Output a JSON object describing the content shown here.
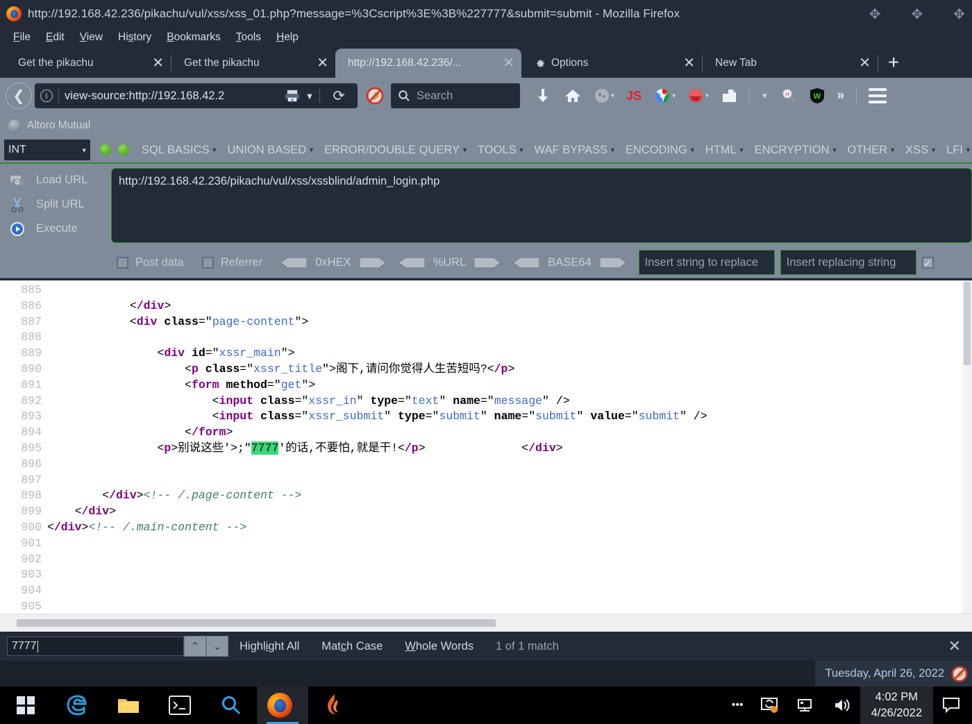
{
  "window": {
    "title": "http://192.168.42.236/pikachu/vul/xss/xss_01.php?message=%3Cscript%3E%3B%227777&submit=submit - Mozilla Firefox",
    "minimize": "—",
    "maximize": "▫",
    "close": "✕"
  },
  "menubar": [
    {
      "label": "File"
    },
    {
      "label": "Edit"
    },
    {
      "label": "View"
    },
    {
      "label": "History"
    },
    {
      "label": "Bookmarks"
    },
    {
      "label": "Tools"
    },
    {
      "label": "Help"
    }
  ],
  "tabs": [
    {
      "label": "Get the pikachu",
      "close": "✕",
      "active": false
    },
    {
      "label": "Get the pikachu",
      "close": "✕",
      "active": false
    },
    {
      "label": "http://192.168.42.236/...",
      "close": "✕",
      "active": true
    },
    {
      "label": "Options",
      "close": "✕",
      "active": false
    },
    {
      "label": "New Tab",
      "close": "✕",
      "active": false
    }
  ],
  "newtab_label": "+",
  "navbar": {
    "back_arrow": "❮",
    "identity_icon": "i",
    "url": "view-source:http://192.168.42.2",
    "dropdown_caret": "▼",
    "reload_glyph": "⟳",
    "search_placeholder": "Search",
    "search_icon": "🔍",
    "js_label": "JS",
    "overflow_caret": "»"
  },
  "bookmarks": [
    {
      "label": "Altoro Mutual"
    }
  ],
  "hackbar": {
    "type_select": "INT",
    "select_caret": "▾",
    "menus": [
      {
        "label": "SQL BASICS"
      },
      {
        "label": "UNION BASED"
      },
      {
        "label": "ERROR/DOUBLE QUERY"
      },
      {
        "label": "TOOLS"
      },
      {
        "label": "WAF BYPASS"
      },
      {
        "label": "ENCODING"
      },
      {
        "label": "HTML"
      },
      {
        "label": "ENCRYPTION"
      },
      {
        "label": "OTHER"
      },
      {
        "label": "XSS"
      },
      {
        "label": "LFI"
      }
    ],
    "actions": [
      {
        "label": "Load URL"
      },
      {
        "label": "Split URL"
      },
      {
        "label": "Execute"
      }
    ],
    "url_value": "http://192.168.42.236/pikachu/vul/xss/xssblind/admin_login.php",
    "post_data_label": "Post data",
    "referrer_label": "Referrer",
    "encoders": [
      {
        "label": "0xHEX"
      },
      {
        "label": "%URL"
      },
      {
        "label": "BASE64"
      }
    ],
    "replace_placeholder": "Insert string to replace",
    "replacing_placeholder": "Insert replacing string"
  },
  "source": {
    "lines": [
      {
        "num": "885",
        "tokens": []
      },
      {
        "num": "886",
        "tokens": [
          {
            "t": "pk",
            "s": "            "
          },
          {
            "t": "pk",
            "s": "<"
          },
          {
            "t": "tg",
            "s": "/div"
          },
          {
            "t": "pk",
            "s": ">"
          }
        ]
      },
      {
        "num": "887",
        "tokens": [
          {
            "t": "pk",
            "s": "            "
          },
          {
            "t": "pk",
            "s": "<"
          },
          {
            "t": "tg",
            "s": "div"
          },
          {
            "t": "at",
            "s": " class"
          },
          {
            "t": "pk",
            "s": "=\""
          },
          {
            "t": "vl",
            "s": "page-content"
          },
          {
            "t": "pk",
            "s": "\">"
          }
        ]
      },
      {
        "num": "888",
        "tokens": []
      },
      {
        "num": "889",
        "tokens": [
          {
            "t": "pk",
            "s": "                "
          },
          {
            "t": "pk",
            "s": "<"
          },
          {
            "t": "tg",
            "s": "div"
          },
          {
            "t": "at",
            "s": " id"
          },
          {
            "t": "pk",
            "s": "=\""
          },
          {
            "t": "vl",
            "s": "xssr_main"
          },
          {
            "t": "pk",
            "s": "\">"
          }
        ]
      },
      {
        "num": "890",
        "tokens": [
          {
            "t": "pk",
            "s": "                    "
          },
          {
            "t": "pk",
            "s": "<"
          },
          {
            "t": "tg",
            "s": "p"
          },
          {
            "t": "at",
            "s": " class"
          },
          {
            "t": "pk",
            "s": "=\""
          },
          {
            "t": "vl",
            "s": "xssr_title"
          },
          {
            "t": "pk",
            "s": "\">"
          },
          {
            "t": "pk",
            "s": "阁下,请问你觉得人生苦短吗?"
          },
          {
            "t": "pk",
            "s": "<"
          },
          {
            "t": "tg",
            "s": "/p"
          },
          {
            "t": "pk",
            "s": ">"
          }
        ]
      },
      {
        "num": "891",
        "tokens": [
          {
            "t": "pk",
            "s": "                    "
          },
          {
            "t": "pk",
            "s": "<"
          },
          {
            "t": "tg",
            "s": "form"
          },
          {
            "t": "at",
            "s": " method"
          },
          {
            "t": "pk",
            "s": "=\""
          },
          {
            "t": "vl",
            "s": "get"
          },
          {
            "t": "pk",
            "s": "\">"
          }
        ]
      },
      {
        "num": "892",
        "tokens": [
          {
            "t": "pk",
            "s": "                        "
          },
          {
            "t": "pk",
            "s": "<"
          },
          {
            "t": "tg",
            "s": "input"
          },
          {
            "t": "at",
            "s": " class"
          },
          {
            "t": "pk",
            "s": "=\""
          },
          {
            "t": "vl",
            "s": "xssr_in"
          },
          {
            "t": "pk",
            "s": "\""
          },
          {
            "t": "at",
            "s": " type"
          },
          {
            "t": "pk",
            "s": "=\""
          },
          {
            "t": "vl",
            "s": "text"
          },
          {
            "t": "pk",
            "s": "\""
          },
          {
            "t": "at",
            "s": " name"
          },
          {
            "t": "pk",
            "s": "=\""
          },
          {
            "t": "vl",
            "s": "message"
          },
          {
            "t": "pk",
            "s": "\" />"
          }
        ]
      },
      {
        "num": "893",
        "tokens": [
          {
            "t": "pk",
            "s": "                        "
          },
          {
            "t": "pk",
            "s": "<"
          },
          {
            "t": "tg",
            "s": "input"
          },
          {
            "t": "at",
            "s": " class"
          },
          {
            "t": "pk",
            "s": "=\""
          },
          {
            "t": "vl",
            "s": "xssr_submit"
          },
          {
            "t": "pk",
            "s": "\""
          },
          {
            "t": "at",
            "s": " type"
          },
          {
            "t": "pk",
            "s": "=\""
          },
          {
            "t": "vl",
            "s": "submit"
          },
          {
            "t": "pk",
            "s": "\""
          },
          {
            "t": "at",
            "s": " name"
          },
          {
            "t": "pk",
            "s": "=\""
          },
          {
            "t": "vl",
            "s": "submit"
          },
          {
            "t": "pk",
            "s": "\""
          },
          {
            "t": "at",
            "s": " value"
          },
          {
            "t": "pk",
            "s": "=\""
          },
          {
            "t": "vl",
            "s": "submit"
          },
          {
            "t": "pk",
            "s": "\" />"
          }
        ]
      },
      {
        "num": "894",
        "tokens": [
          {
            "t": "pk",
            "s": "                    "
          },
          {
            "t": "pk",
            "s": "<"
          },
          {
            "t": "tg",
            "s": "/form"
          },
          {
            "t": "pk",
            "s": ">"
          }
        ]
      },
      {
        "num": "895",
        "tokens": [
          {
            "t": "pk",
            "s": "                "
          },
          {
            "t": "pk",
            "s": "<"
          },
          {
            "t": "tg",
            "s": "p"
          },
          {
            "t": "pk",
            "s": ">"
          },
          {
            "t": "pk",
            "s": "别说这些'>;\""
          },
          {
            "t": "hl",
            "s": "7777"
          },
          {
            "t": "pk",
            "s": "'的话,不要怕,就是干!"
          },
          {
            "t": "pk",
            "s": "<"
          },
          {
            "t": "tg",
            "s": "/p"
          },
          {
            "t": "pk",
            "s": ">"
          },
          {
            "t": "pk",
            "s": "              "
          },
          {
            "t": "pk",
            "s": "<"
          },
          {
            "t": "tg",
            "s": "/div"
          },
          {
            "t": "pk",
            "s": ">"
          }
        ]
      },
      {
        "num": "896",
        "tokens": []
      },
      {
        "num": "897",
        "tokens": []
      },
      {
        "num": "898",
        "tokens": [
          {
            "t": "pk",
            "s": "        "
          },
          {
            "t": "pk",
            "s": "<"
          },
          {
            "t": "tg",
            "s": "/div"
          },
          {
            "t": "pk",
            "s": ">"
          },
          {
            "t": "cm",
            "s": "<!-- /.page-content -->"
          }
        ]
      },
      {
        "num": "899",
        "tokens": [
          {
            "t": "pk",
            "s": "    "
          },
          {
            "t": "pk",
            "s": "<"
          },
          {
            "t": "tg",
            "s": "/div"
          },
          {
            "t": "pk",
            "s": ">"
          }
        ]
      },
      {
        "num": "900",
        "tokens": [
          {
            "t": "pk",
            "s": "<"
          },
          {
            "t": "tg",
            "s": "/div"
          },
          {
            "t": "pk",
            "s": ">"
          },
          {
            "t": "cm",
            "s": "<!-- /.main-content -->"
          }
        ]
      },
      {
        "num": "901",
        "tokens": []
      },
      {
        "num": "902",
        "tokens": []
      },
      {
        "num": "903",
        "tokens": []
      },
      {
        "num": "904",
        "tokens": []
      },
      {
        "num": "905",
        "tokens": []
      }
    ]
  },
  "findbar": {
    "query": "7777",
    "prev_glyph": "⌃",
    "next_glyph": "⌄",
    "highlight_all": "Highlight All",
    "match_case": "Match Case",
    "whole_words": "Whole Words",
    "status": "1 of 1 match",
    "close": "✕"
  },
  "desktop": {
    "date_long": "Tuesday, April 26, 2022",
    "tray_time": "4:02 PM",
    "tray_date": "4/26/2022",
    "overflow": "•••"
  }
}
